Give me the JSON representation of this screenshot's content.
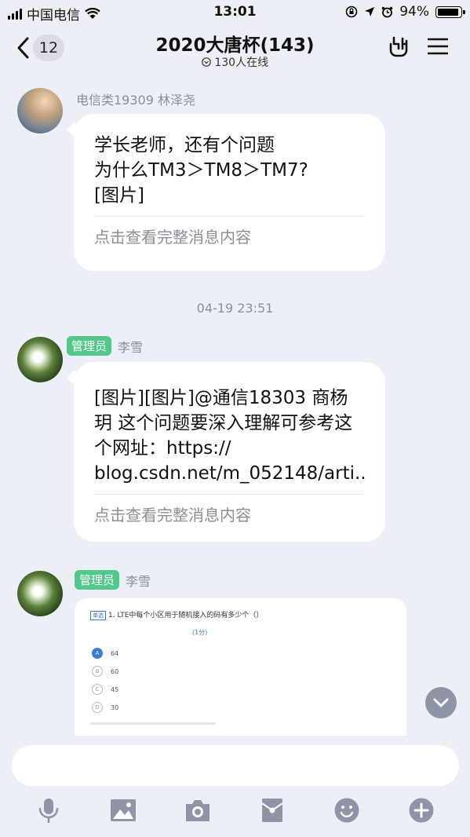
{
  "status_bar": {
    "carrier": "中国电信",
    "time": "13:01",
    "battery": "94%"
  },
  "header": {
    "back_count": "12",
    "title": "2020大唐杯(143)",
    "online": "130人在线"
  },
  "messages": [
    {
      "sender": "电信类19309 林泽尧",
      "text": "学长老师，还有个问题\n为什么TM3＞TM8＞TM7?\n[图片]",
      "more": "点击查看完整消息内容"
    },
    {
      "role": "管理员",
      "sender": "李雪",
      "text": "[图片][图片]@通信18303  商杨玥 这个问题要深入理解可参考这个网址：https://\nblog.csdn.net/m_052148/arti...",
      "more": "点击查看完整消息内容"
    },
    {
      "role": "管理员",
      "sender": "李雪"
    }
  ],
  "timestamp": "04-19 23:51",
  "image_message": {
    "question": "1. LTE中每个小区用于随机接入的码有多少个（）",
    "question_tag": "单选",
    "score": "(1分)",
    "options": [
      {
        "letter": "A",
        "value": "64",
        "selected": true
      },
      {
        "letter": "B",
        "value": "60",
        "selected": false
      },
      {
        "letter": "C",
        "value": "45",
        "selected": false
      },
      {
        "letter": "D",
        "value": "30",
        "selected": false
      }
    ]
  },
  "input": {
    "placeholder": ""
  },
  "toolbar": [
    "mic-icon",
    "image-icon",
    "camera-icon",
    "red-packet-icon",
    "emoji-icon",
    "plus-icon"
  ]
}
